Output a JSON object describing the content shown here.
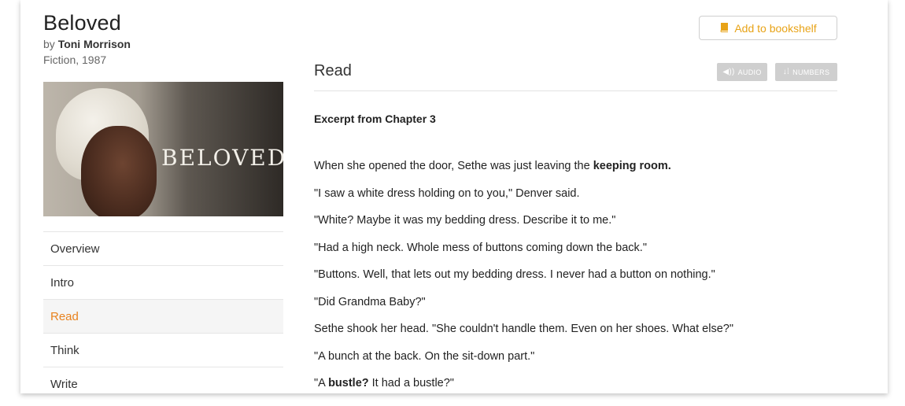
{
  "book": {
    "title": "Beloved",
    "author_prefix": "by",
    "author": "Toni Morrison",
    "meta": "Fiction, 1987",
    "cover_text": "BELOVED"
  },
  "nav": {
    "items": [
      {
        "label": "Overview",
        "active": false
      },
      {
        "label": "Intro",
        "active": false
      },
      {
        "label": "Read",
        "active": true
      },
      {
        "label": "Think",
        "active": false
      },
      {
        "label": "Write",
        "active": false
      }
    ]
  },
  "actions": {
    "bookshelf_label": "Add to bookshelf",
    "bookshelf_icon": "book-icon",
    "audio_label": "AUDIO",
    "audio_icon": "speaker-icon",
    "numbers_label": "NUMBERS",
    "numbers_icon": "line-numbers-icon"
  },
  "main": {
    "heading": "Read",
    "excerpt_title": "Excerpt from Chapter 3",
    "lines": [
      {
        "before": "When she opened the door, Sethe was just leaving the ",
        "bold": "keeping room.",
        "after": ""
      },
      {
        "before": "\"I saw a white dress holding on to you,\" Denver said.",
        "bold": "",
        "after": ""
      },
      {
        "before": "\"White? Maybe it was my bedding dress. Describe it to me.\"",
        "bold": "",
        "after": ""
      },
      {
        "before": "\"Had a high neck. Whole mess of buttons coming down the back.\"",
        "bold": "",
        "after": ""
      },
      {
        "before": "\"Buttons. Well, that lets out my bedding dress. I never had a button on nothing.\"",
        "bold": "",
        "after": ""
      },
      {
        "before": "\"Did Grandma Baby?\"",
        "bold": "",
        "after": ""
      },
      {
        "before": "Sethe shook her head. \"She couldn't handle them. Even on her shoes. What else?\"",
        "bold": "",
        "after": ""
      },
      {
        "before": "\"A bunch at the back. On the sit-down part.\"",
        "bold": "",
        "after": ""
      },
      {
        "before": "\"A ",
        "bold": "bustle?",
        "after": " It had a bustle?\""
      }
    ]
  },
  "colors": {
    "accent": "#e8821e",
    "bookshelf": "#e8a317",
    "pill_bg": "#cfcfcf"
  }
}
